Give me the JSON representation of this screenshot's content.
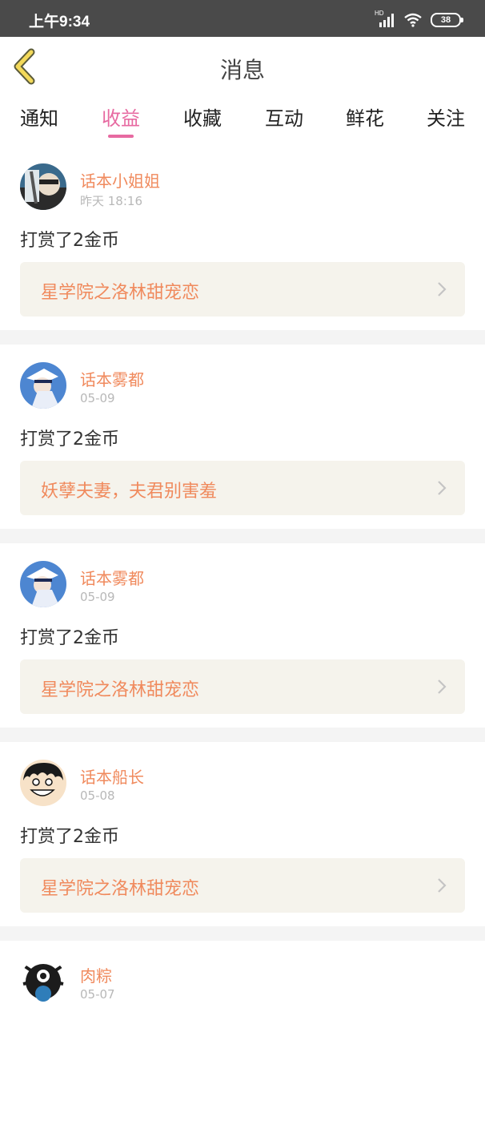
{
  "status_bar": {
    "time": "上午9:34",
    "network": "HD",
    "battery": "38"
  },
  "header": {
    "title": "消息",
    "back_icon": "chevron-left-icon"
  },
  "tabs": [
    {
      "label": "通知",
      "active": false
    },
    {
      "label": "收益",
      "active": true
    },
    {
      "label": "收藏",
      "active": false
    },
    {
      "label": "互动",
      "active": false
    },
    {
      "label": "鲜花",
      "active": false
    },
    {
      "label": "关注",
      "active": false
    }
  ],
  "colors": {
    "accent": "#e76aa1",
    "username": "#f08a5d",
    "book_bg": "#f5f3ec"
  },
  "messages": [
    {
      "username": "话本小姐姐",
      "time": "昨天 18:16",
      "action": "打赏了2金币",
      "book": "星学院之洛林甜宠恋"
    },
    {
      "username": "话本雾都",
      "time": "05-09",
      "action": "打赏了2金币",
      "book": "妖孽夫妻，夫君别害羞"
    },
    {
      "username": "话本雾都",
      "time": "05-09",
      "action": "打赏了2金币",
      "book": "星学院之洛林甜宠恋"
    },
    {
      "username": "话本船长",
      "time": "05-08",
      "action": "打赏了2金币",
      "book": "星学院之洛林甜宠恋"
    },
    {
      "username": "肉粽",
      "time": "05-07"
    }
  ]
}
